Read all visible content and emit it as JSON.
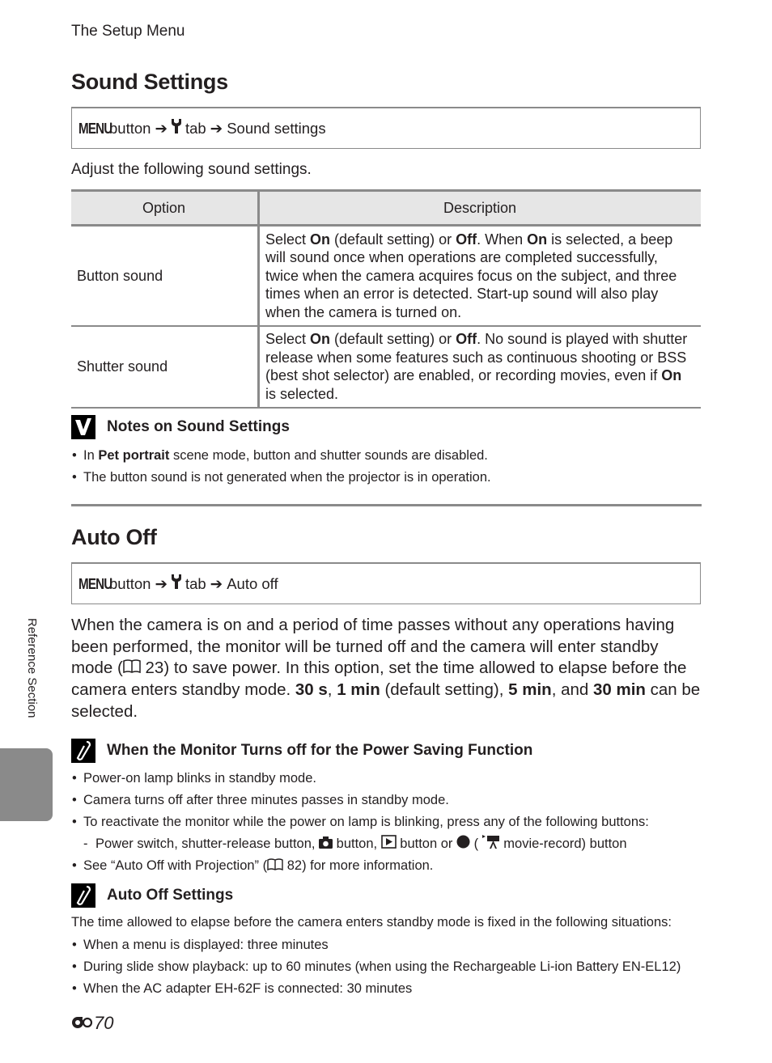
{
  "running_head": "The Setup Menu",
  "sound_settings": {
    "title": "Sound Settings",
    "nav": {
      "menu": "MENU",
      "button": "button",
      "tab": "tab",
      "target": "Sound settings",
      "arrow": "➔"
    },
    "intro": "Adjust the following sound settings.",
    "table": {
      "headers": [
        "Option",
        "Description"
      ],
      "rows": [
        {
          "option": "Button sound",
          "desc": [
            {
              "t": "Select "
            },
            {
              "b": "On"
            },
            {
              "t": " (default setting) or "
            },
            {
              "b": "Off"
            },
            {
              "t": ". When "
            },
            {
              "b": "On"
            },
            {
              "t": " is selected, a beep will sound once when operations are completed successfully, twice when the camera acquires focus on the subject, and three times when an error is detected. Start-up sound will also play when the camera is turned on."
            }
          ]
        },
        {
          "option": "Shutter sound",
          "desc": [
            {
              "t": "Select "
            },
            {
              "b": "On"
            },
            {
              "t": " (default setting) or "
            },
            {
              "b": "Off"
            },
            {
              "t": ". No sound is played with shutter release when some features such as continuous shooting or BSS (best shot selector) are enabled, or recording movies, even if "
            },
            {
              "b": "On"
            },
            {
              "t": " is selected."
            }
          ]
        }
      ]
    },
    "notes": {
      "icon": "check-icon",
      "title": "Notes on Sound Settings",
      "items": [
        {
          "pre": "In ",
          "bold": "Pet portrait",
          "post": " scene mode, button and shutter sounds are disabled."
        },
        {
          "pre": "The button sound is not generated when the projector is in operation.",
          "bold": "",
          "post": ""
        }
      ]
    }
  },
  "auto_off": {
    "title": "Auto Off",
    "nav": {
      "menu": "MENU",
      "button": "button",
      "tab": "tab",
      "target": "Auto off",
      "arrow": "➔"
    },
    "paragraph": [
      {
        "t": "When the camera is on and a period of time passes without any operations having been performed, the monitor will be turned off and the camera will enter standby mode ("
      },
      {
        "ref": "23"
      },
      {
        "t": ") to save power. In this option, set the time allowed to elapse before the camera enters standby mode. "
      },
      {
        "b": "30 s"
      },
      {
        "t": ", "
      },
      {
        "b": "1 min"
      },
      {
        "t": " (default setting), "
      },
      {
        "b": "5 min"
      },
      {
        "t": ", and "
      },
      {
        "b": "30 min"
      },
      {
        "t": " can be selected."
      }
    ],
    "power_saving_note": {
      "icon": "pencil-icon",
      "title": "When the Monitor Turns off for the Power Saving Function",
      "items": [
        "Power-on lamp blinks in standby mode.",
        "Camera turns off after three minutes passes in standby mode.",
        "To reactivate the monitor while the power on lamp is blinking, press any of the following buttons:"
      ],
      "sub_item": {
        "pre": "Power switch, shutter-release button, ",
        "camera_btn": "button, ",
        "play_btn": "button or ",
        "record_pre": " (",
        "record_post": " movie-record) button"
      },
      "last_item": {
        "pre": "See “Auto Off with Projection” (",
        "ref": "82",
        "post": ") for more information."
      }
    },
    "settings_note": {
      "icon": "pencil-icon",
      "title": "Auto Off Settings",
      "intro": "The time allowed to elapse before the camera enters standby mode is fixed in the following situations:",
      "items": [
        "When a menu is displayed: three minutes",
        "During slide show playback: up to 60 minutes (when using the Rechargeable Li-ion Battery EN-EL12)",
        "When the AC adapter EH-62F is connected: 30 minutes"
      ]
    }
  },
  "side_tab_label": "Reference Section",
  "page_number": "70",
  "colors": {
    "rule": "#8a8a8a",
    "header_bg": "#e6e6e6",
    "side_tab": "#8a8a8a",
    "text": "#231f20"
  }
}
